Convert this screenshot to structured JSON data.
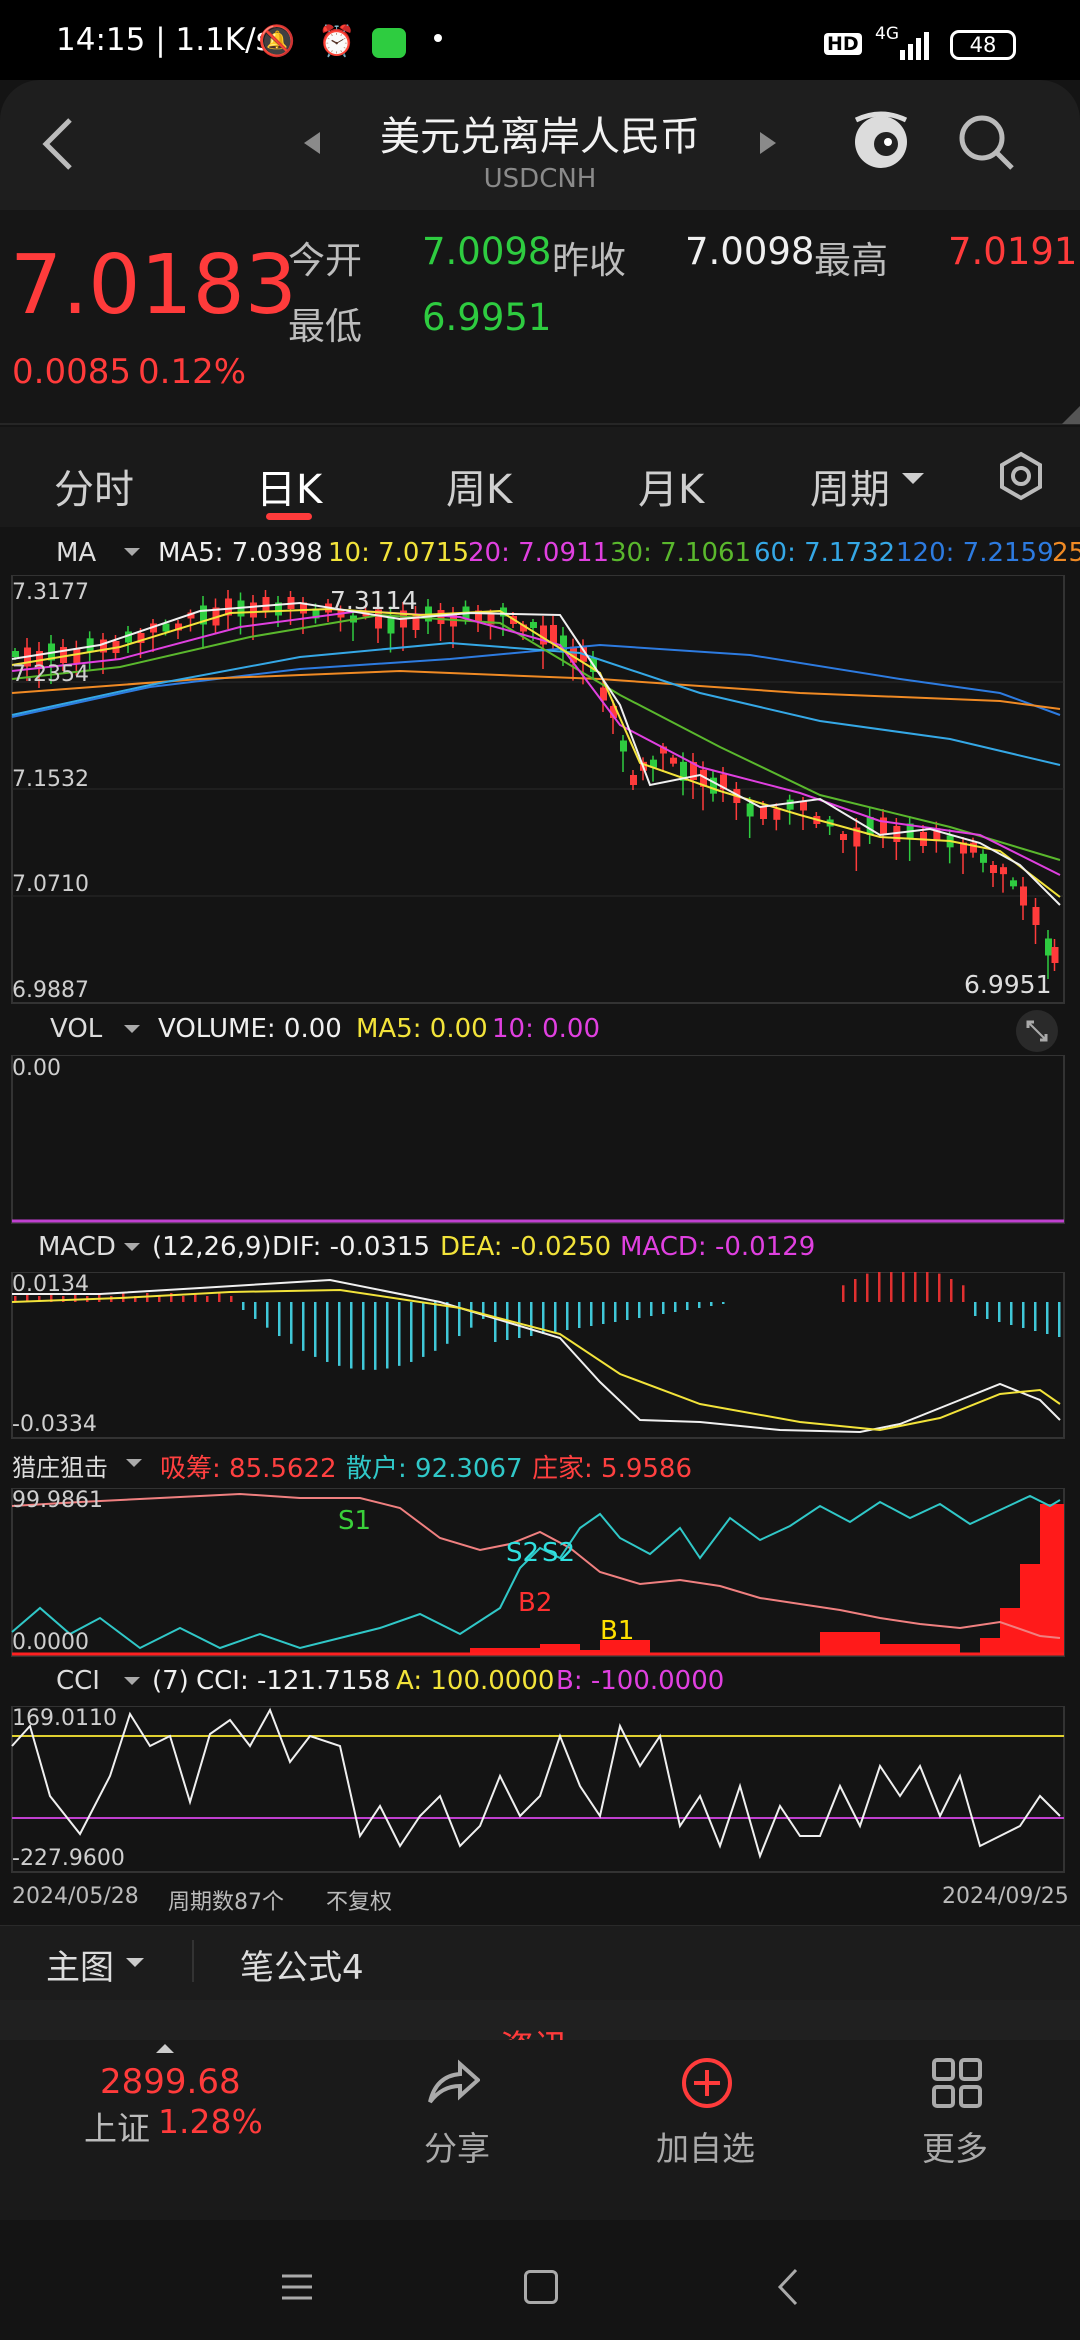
{
  "status_bar": {
    "time_speed": "14:15 | 1.1K/s",
    "hd": "HD",
    "network": "4G",
    "battery": "48"
  },
  "header": {
    "title": "美元兑离岸人民币",
    "code": "USDCNH"
  },
  "quote": {
    "price": "7.0183",
    "change": "0.0085",
    "change_pct": "0.12%",
    "open_label": "今开",
    "open": "7.0098",
    "prev_close_label": "昨收",
    "prev_close": "7.0098",
    "high_label": "最高",
    "high": "7.0191",
    "low_label": "最低",
    "low": "6.9951"
  },
  "tabs": [
    {
      "label": "分时"
    },
    {
      "label": "日K"
    },
    {
      "label": "周K"
    },
    {
      "label": "月K"
    },
    {
      "label": "周期"
    }
  ],
  "ma_panel": {
    "indicator": "MA",
    "ma5": "MA5: 7.0398",
    "ma10": "10: 7.0715",
    "ma20": "20: 7.0911",
    "ma30": "30: 7.1061",
    "ma60": "60: 7.1732",
    "ma120": "120: 7.2159",
    "ma250": "25",
    "y_labels": [
      "7.3177",
      "7.2354",
      "7.1532",
      "7.0710",
      "6.9887"
    ],
    "peak_label": "7.3114",
    "low_label": "6.9951"
  },
  "vol_panel": {
    "indicator": "VOL",
    "volume": "VOLUME: 0.00",
    "ma5": "MA5: 0.00",
    "ma10": "10: 0.00",
    "y_label": "0.00"
  },
  "macd_panel": {
    "indicator": "MACD",
    "params": "(12,26,9)",
    "dif": "DIF: -0.0315",
    "dea": "DEA: -0.0250",
    "macd": "MACD: -0.0129",
    "y_top": "0.0134",
    "y_bottom": "-0.0334"
  },
  "zhuang_panel": {
    "indicator": "猎庄狙击",
    "xichou": "吸筹: 85.5622",
    "sanhu": "散户: 92.3067",
    "zhuangjia": "庄家: 5.9586",
    "y_top": "99.9861",
    "y_bottom": "0.0000",
    "markers": [
      "S1",
      "S2",
      "S2",
      "B2",
      "B1"
    ]
  },
  "cci_panel": {
    "indicator": "CCI",
    "params": "(7)",
    "cci": "CCI: -121.7158",
    "a": "A: 100.0000",
    "b": "B: -100.0000",
    "y_top": "169.0110",
    "y_bottom": "-227.9600"
  },
  "footer_axis": {
    "start_date": "2024/05/28",
    "period_count": "周期数87个",
    "adjust": "不复权",
    "end_date": "2024/09/25"
  },
  "sub_bar": {
    "main": "主图",
    "formula": "笔公式4",
    "hidden_text": "资讯"
  },
  "bottom_bar": {
    "index_value": "2899.68",
    "index_name": "上证",
    "index_pct": "1.28%",
    "share": "分享",
    "add": "加自选",
    "more": "更多"
  },
  "colors": {
    "up": "#ff3b3b",
    "down": "#2ecc40",
    "ma5": "#f0f0f0",
    "ma10": "#f2e33a",
    "ma20": "#e040e0",
    "ma30": "#5ab82d",
    "ma60": "#35a8e6",
    "ma120": "#2d7be0",
    "ma250": "#f08a24"
  }
}
